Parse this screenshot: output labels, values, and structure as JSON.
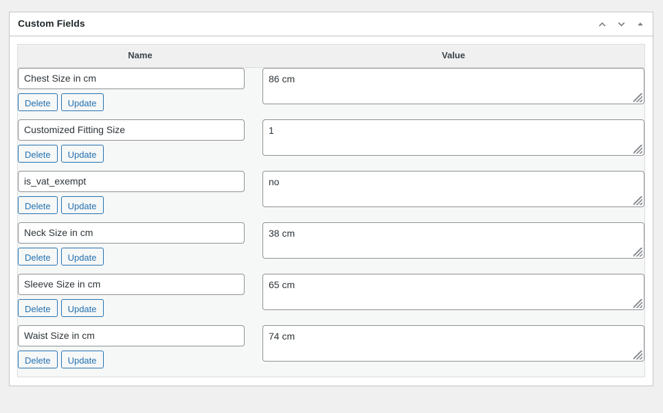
{
  "panel": {
    "title": "Custom Fields",
    "handle_actions": [
      {
        "name": "move-up-icon",
        "label": "Move up"
      },
      {
        "name": "move-down-icon",
        "label": "Move down"
      },
      {
        "name": "toggle-panel-icon",
        "label": "Toggle panel: Custom Fields"
      }
    ]
  },
  "table": {
    "headers": {
      "name": "Name",
      "value": "Value"
    },
    "row_actions": {
      "delete": "Delete",
      "update": "Update"
    },
    "rows": [
      {
        "name": "Chest Size in cm",
        "value": "86 cm"
      },
      {
        "name": "Customized Fitting Size",
        "value": "1"
      },
      {
        "name": "is_vat_exempt",
        "value": "no"
      },
      {
        "name": "Neck Size in cm",
        "value": "38 cm"
      },
      {
        "name": "Sleeve Size in cm",
        "value": "65 cm"
      },
      {
        "name": "Waist Size in cm",
        "value": "74 cm"
      }
    ]
  },
  "colors": {
    "accent": "#2271b1",
    "panel_border": "#c3c4c7",
    "inner_bg": "#f6f7f7",
    "header_bg": "#f0f0f1",
    "text": "#3c434a",
    "title": "#1d2327",
    "field_border": "#8c8f94",
    "icon": "#787c82"
  }
}
